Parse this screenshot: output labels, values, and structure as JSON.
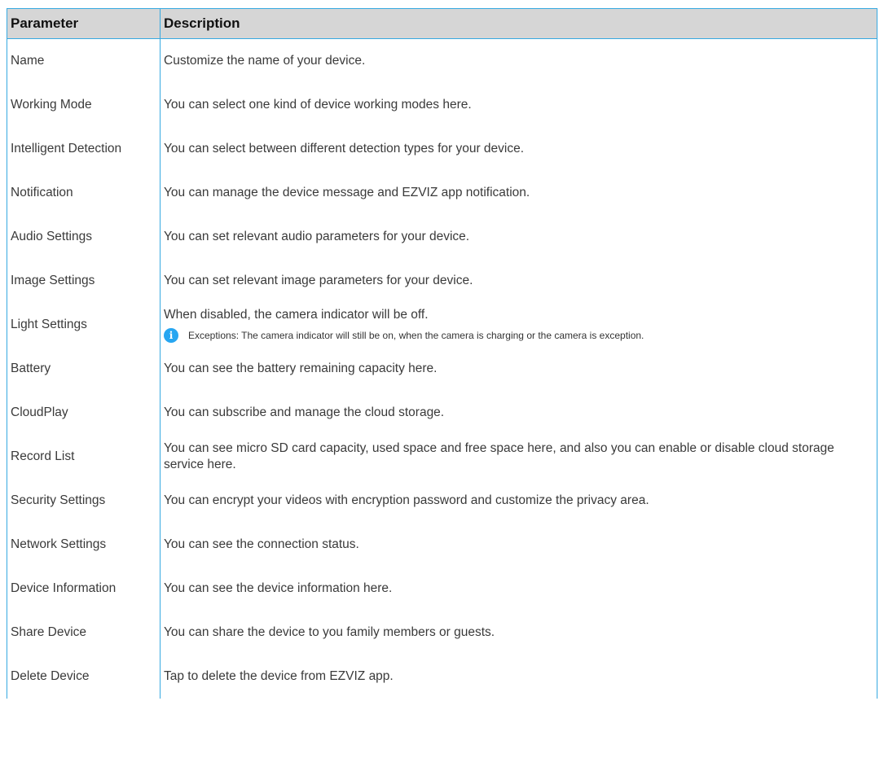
{
  "table": {
    "headers": {
      "param": "Parameter",
      "desc": "Description"
    },
    "rows": [
      {
        "param": "Name",
        "desc": "Customize the name of your device."
      },
      {
        "param": "Working Mode",
        "desc": "You can select one kind of device working modes here."
      },
      {
        "param": "Intelligent Detection",
        "desc": "You can select between different detection types for your device."
      },
      {
        "param": "Notification",
        "desc": "You can manage the device message and EZVIZ app notification."
      },
      {
        "param": "Audio Settings",
        "desc": "You can set relevant audio parameters for your device."
      },
      {
        "param": "Image Settings",
        "desc": "You can set relevant image parameters for your device."
      },
      {
        "param": "Light Settings",
        "desc": "When disabled, the camera indicator will be off.",
        "note": "Exceptions: The camera indicator will still be on, when the camera is charging or the camera is exception.",
        "note_icon": "info-icon"
      },
      {
        "param": "Battery",
        "desc": "You can see the battery remaining capacity here."
      },
      {
        "param": "CloudPlay",
        "desc": "You can subscribe and manage the cloud storage."
      },
      {
        "param": "Record List",
        "desc": "You can see micro SD card capacity, used space and free space here, and also you can enable or disable cloud storage service here."
      },
      {
        "param": "Security Settings",
        "desc": "You can encrypt your videos with encryption password and customize the privacy area."
      },
      {
        "param": "Network Settings",
        "desc": "You can see the connection status."
      },
      {
        "param": "Device Information",
        "desc": "You can see the device information here."
      },
      {
        "param": "Share Device",
        "desc": "You can share the device to you family members or guests."
      },
      {
        "param": "Delete Device",
        "desc": "Tap to delete the device from EZVIZ app."
      }
    ]
  },
  "icons": {
    "info": "i"
  },
  "colors": {
    "border": "#36a9e1",
    "header_bg": "#d6d6d6",
    "info_icon": "#27a6f1"
  }
}
